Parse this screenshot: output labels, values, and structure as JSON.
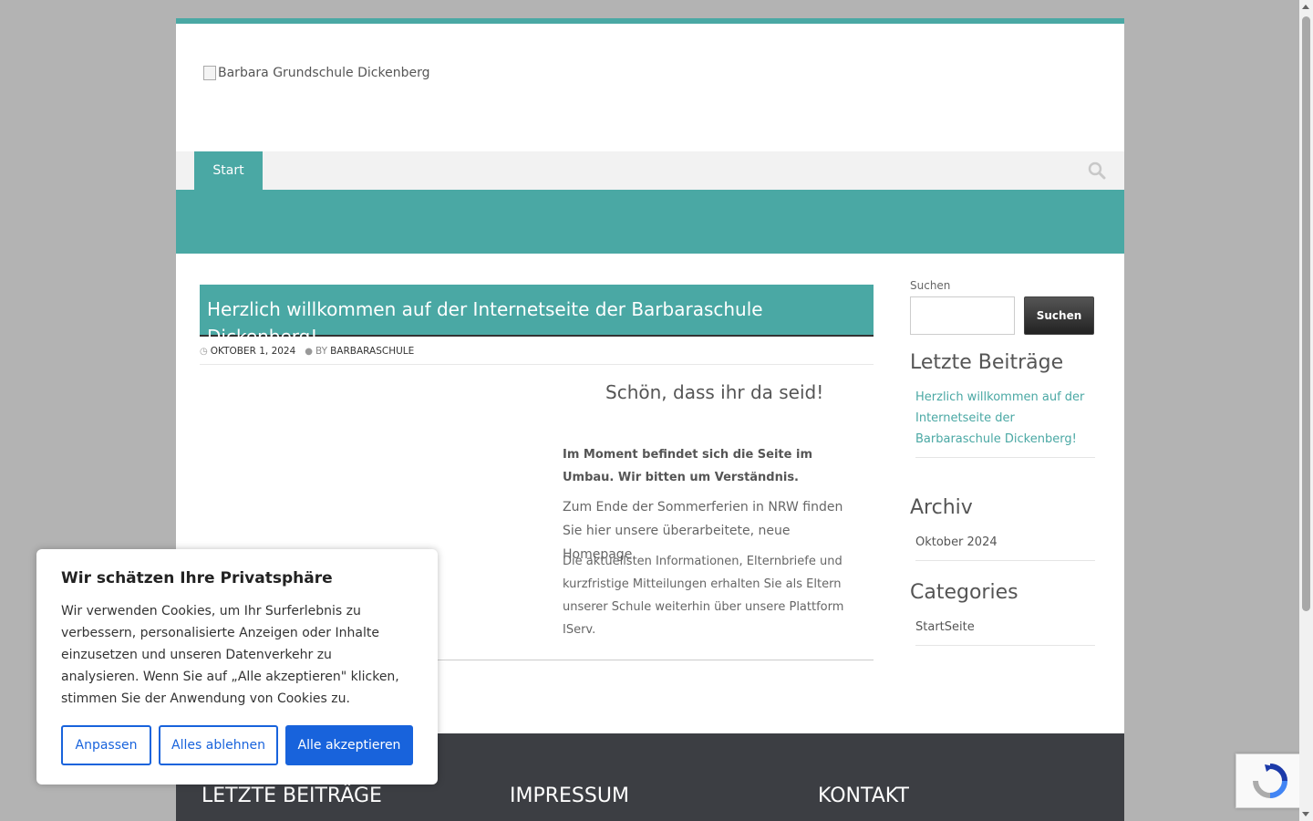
{
  "header": {
    "logo_alt": "Barbara Grundschule Dickenberg"
  },
  "nav": {
    "items": [
      {
        "label": "Start"
      }
    ],
    "search_icon": "search-icon"
  },
  "post": {
    "title": "Herzlich willkommen auf der Internetseite der Barbaraschule Dickenberg!",
    "date": "OKTOBER 1, 2024",
    "by": "BY",
    "author": "BARBARASCHULE",
    "greeting": "Schön, dass ihr da seid!",
    "notice": "Im Moment befindet sich die Seite im Umbau. Wir bitten um Verständnis.",
    "paragraph2": "Zum Ende der Sommerferien in NRW finden Sie hier unsere überarbeitete, neue Homepage.",
    "paragraph3": "Die aktuellsten Informationen, Elternbriefe und kurzfristige Mitteilungen erhalten Sie als Eltern unserer Schule weiterhin über unsere Plattform IServ."
  },
  "sidebar": {
    "search_label": "Suchen",
    "search_button": "Suchen",
    "recent_title": "Letzte Beiträge",
    "recent_items": [
      {
        "label": "Herzlich willkommen auf der Internetseite der Barbaraschule Dickenberg!"
      }
    ],
    "archive_title": "Archiv",
    "archive_items": [
      {
        "label": "Oktober 2024"
      }
    ],
    "categories_title": "Categories",
    "category_items": [
      {
        "label": "StartSeite"
      }
    ]
  },
  "footer": {
    "col1": "LETZTE BEITRÄGE",
    "col2": "IMPRESSUM",
    "col3": "KONTAKT"
  },
  "cookie": {
    "title": "Wir schätzen Ihre Privatsphäre",
    "text": "Wir verwenden Cookies, um Ihr Surferlebnis zu verbessern, personalisierte Anzeigen oder Inhalte einzusetzen und unseren Datenverkehr zu analysieren. Wenn Sie auf „Alle akzeptieren\" klicken, stimmen Sie der Anwendung von Cookies zu.",
    "customize": "Anpassen",
    "reject": "Alles ablehnen",
    "accept": "Alle akzeptieren"
  },
  "colors": {
    "accent": "#4aa8a4",
    "cookie_blue": "#1863dc",
    "footer_bg": "#3c3e43"
  }
}
